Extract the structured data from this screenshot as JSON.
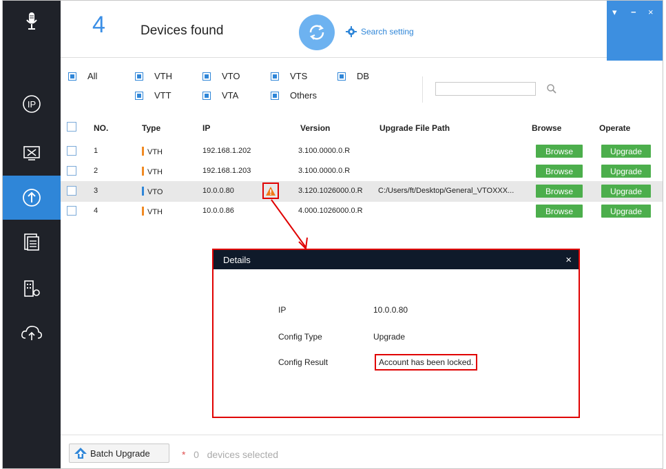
{
  "header": {
    "count": "4",
    "found_label": "Devices found",
    "search_setting": "Search setting"
  },
  "filters": {
    "all": "All",
    "vth": "VTH",
    "vto": "VTO",
    "vts": "VTS",
    "db": "DB",
    "vtt": "VTT",
    "vta": "VTA",
    "others": "Others",
    "search_value": ""
  },
  "table": {
    "headers": [
      "NO.",
      "Type",
      "IP",
      "Version",
      "Upgrade File Path",
      "Browse",
      "Operate"
    ],
    "rows": [
      {
        "no": "1",
        "type": "VTH",
        "ip": "192.168.1.202",
        "version": "3.100.0000.0.R",
        "path": "",
        "browse": "Browse",
        "operate": "Upgrade"
      },
      {
        "no": "2",
        "type": "VTH",
        "ip": "192.168.1.203",
        "version": "3.100.0000.0.R",
        "path": "",
        "browse": "Browse",
        "operate": "Upgrade"
      },
      {
        "no": "3",
        "type": "VTO",
        "ip": "10.0.0.80",
        "version": "3.120.1026000.0.R",
        "path": "C:/Users/ft/Desktop/General_VTOXXX...",
        "browse": "Browse",
        "operate": "Upgrade"
      },
      {
        "no": "4",
        "type": "VTH",
        "ip": "10.0.0.86",
        "version": "4.000.1026000.0.R",
        "path": "",
        "browse": "Browse",
        "operate": "Upgrade"
      }
    ]
  },
  "dialog": {
    "title": "Details",
    "close": "×",
    "ip_label": "IP",
    "ip_value": "10.0.0.80",
    "config_type_label": "Config Type",
    "config_type_value": "Upgrade",
    "config_result_label": "Config Result",
    "config_result_value": "Account has been locked."
  },
  "footer": {
    "batch_upgrade": "Batch Upgrade",
    "asterisk": "*",
    "selected_count": "0",
    "selected_label": "devices selected"
  },
  "window_controls": {
    "menu": "▾",
    "minimize": "−",
    "close": "×"
  },
  "colors": {
    "accent": "#2f86d8",
    "vth": "#f08a24",
    "vto": "#2f86d8",
    "green": "#4cae4c",
    "highlight": "#e00000"
  },
  "icons": [
    "microphone-icon",
    "ip-icon",
    "tools-icon",
    "upgrade-icon",
    "documents-icon",
    "building-settings-icon",
    "cloud-upload-icon"
  ]
}
